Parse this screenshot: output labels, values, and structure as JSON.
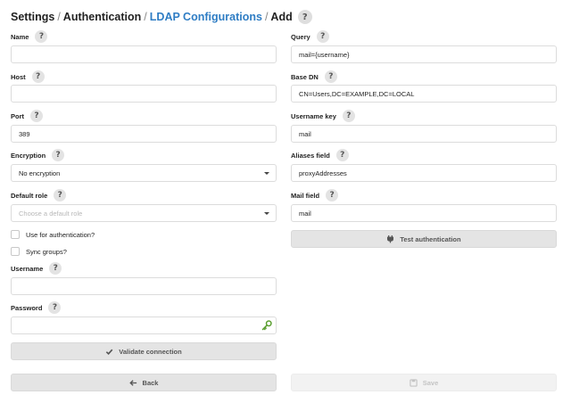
{
  "breadcrumb": {
    "settings": "Settings",
    "authentication": "Authentication",
    "ldap_configurations": "LDAP Configurations",
    "add": "Add",
    "separator": "/"
  },
  "help_glyph": "?",
  "left": {
    "name": {
      "label": "Name",
      "value": ""
    },
    "host": {
      "label": "Host",
      "value": ""
    },
    "port": {
      "label": "Port",
      "value": "389"
    },
    "encryption": {
      "label": "Encryption",
      "selected": "No encryption"
    },
    "default_role": {
      "label": "Default role",
      "placeholder": "Choose a default role"
    },
    "use_for_auth": {
      "label": "Use for authentication?",
      "checked": false
    },
    "sync_groups": {
      "label": "Sync groups?",
      "checked": false
    },
    "username": {
      "label": "Username",
      "value": ""
    },
    "password": {
      "label": "Password",
      "value": ""
    },
    "validate_button": "Validate connection",
    "back_button": "Back"
  },
  "right": {
    "query": {
      "label": "Query",
      "value": "mail={username}"
    },
    "base_dn": {
      "label": "Base DN",
      "value": "CN=Users,DC=EXAMPLE,DC=LOCAL"
    },
    "username_key": {
      "label": "Username key",
      "value": "mail"
    },
    "aliases_field": {
      "label": "Aliases field",
      "value": "proxyAddresses"
    },
    "mail_field": {
      "label": "Mail field",
      "value": "mail"
    },
    "test_button": "Test authentication",
    "save_button": "Save"
  },
  "colors": {
    "link": "#2f7dc4",
    "key_icon": "#5a9e2f"
  },
  "icons": [
    "help-icon",
    "chevron-down-icon",
    "key-icon",
    "check-icon",
    "plug-icon",
    "arrow-left-icon",
    "save-icon"
  ]
}
